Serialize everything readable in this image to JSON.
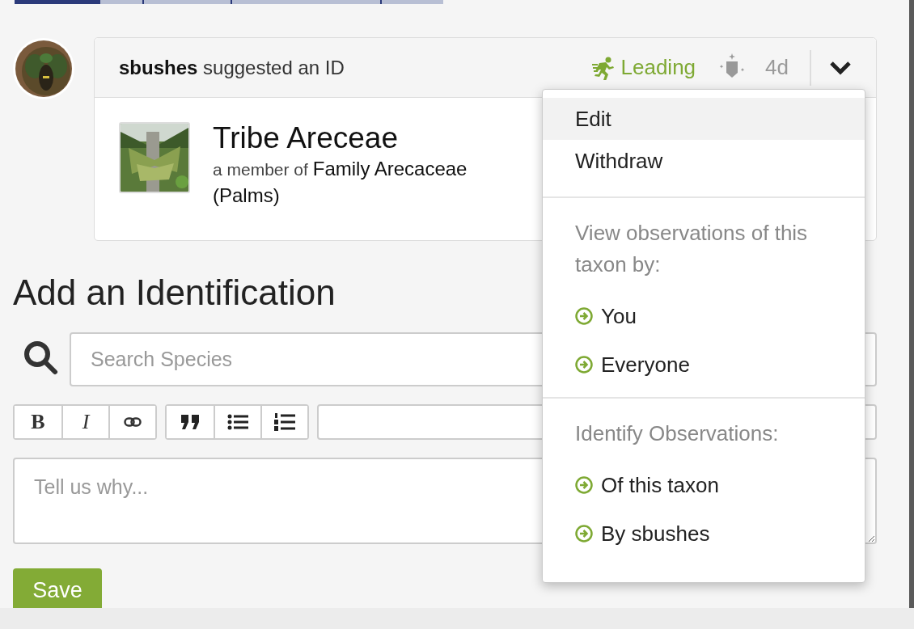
{
  "identification": {
    "user": "sbushes",
    "action": "suggested an ID",
    "status": "Leading",
    "age": "4d",
    "taxon": {
      "name": "Tribe Areceae",
      "member_prefix": "a member of",
      "parent": "Family Arecaceae",
      "common_name": "(Palms)"
    }
  },
  "menu": {
    "sections": [
      {
        "items": [
          {
            "label": "Edit",
            "selected": true
          },
          {
            "label": "Withdraw",
            "selected": false
          }
        ]
      },
      {
        "header": "View observations of this taxon by:",
        "items": [
          {
            "label": "You",
            "selected": false
          },
          {
            "label": "Everyone",
            "selected": false
          }
        ]
      },
      {
        "header": "Identify Observations:",
        "items": [
          {
            "label": "Of this taxon",
            "selected": false
          },
          {
            "label": "By sbushes",
            "selected": false
          }
        ]
      }
    ]
  },
  "form": {
    "heading": "Add an Identification",
    "search": {
      "placeholder": "Search Species"
    },
    "toolbar": [
      [
        {
          "kind": "bold",
          "label": "B"
        },
        {
          "kind": "italic",
          "label": "I"
        },
        {
          "kind": "link"
        }
      ],
      [
        {
          "kind": "quote"
        },
        {
          "kind": "bullets"
        },
        {
          "kind": "numbers"
        }
      ]
    ],
    "remarks": {
      "placeholder": "Tell us why..."
    },
    "save": "Save"
  }
}
